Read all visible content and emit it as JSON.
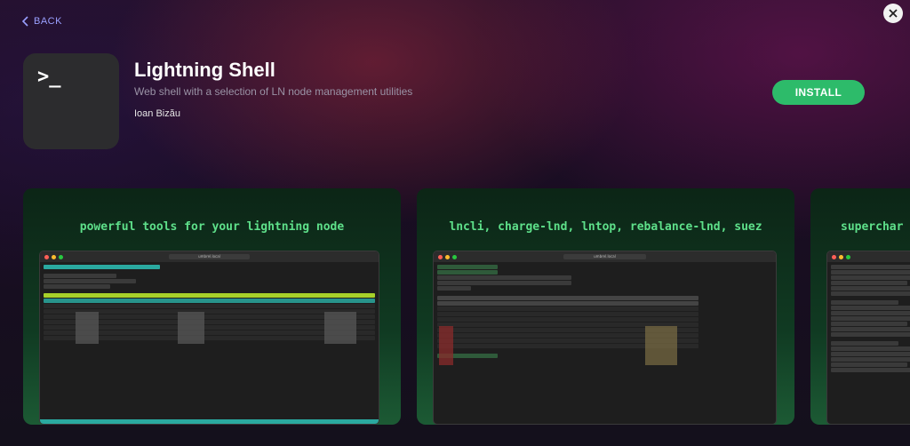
{
  "nav": {
    "back_label": "BACK"
  },
  "app": {
    "icon_glyph": ">_",
    "title": "Lightning Shell",
    "subtitle": "Web shell with a selection of LN node management utilities",
    "author": "Ioan Bizău",
    "install_label": "INSTALL"
  },
  "screenshots": [
    {
      "caption": "powerful tools for your lightning node",
      "url": "umbrel.local"
    },
    {
      "caption": "lncli, charge-lnd, lntop, rebalance-lnd, suez",
      "url": "umbrel.local"
    },
    {
      "caption": "superchar"
    }
  ],
  "colors": {
    "accent": "#2dbb6a",
    "back_link": "#9aa0ff",
    "terminal_green": "#5ee08a"
  }
}
